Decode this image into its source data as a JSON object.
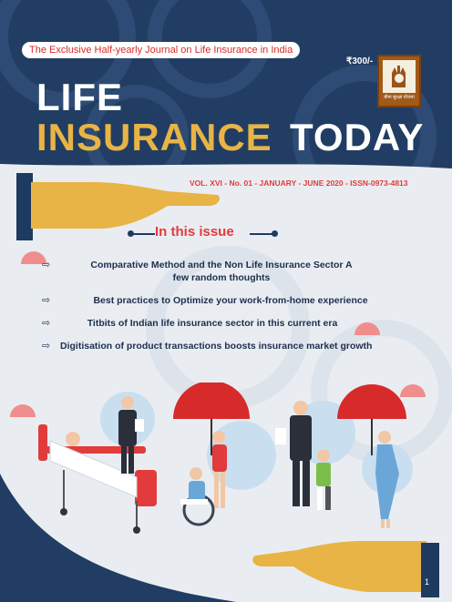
{
  "header": {
    "tagline": "The Exclusive Half-yearly Journal on Life Insurance in India",
    "price": "₹300/-",
    "emblem_text": "बीमा सुरक्षा योजना",
    "title_line1": "LIFE",
    "title_line2a": "INSURANCE",
    "title_line2b": "TODAY",
    "volume_info": "VOL. XVI - No. 01 - JANUARY - JUNE 2020 - ISSN-0973-4813"
  },
  "issue": {
    "heading": "In this issue",
    "items": [
      {
        "text": "Comparative Method and the Non Life Insurance Sector A few random thoughts"
      },
      {
        "text": "Best practices to Optimize your work-from-home experience"
      },
      {
        "text": "Titbits of Indian life insurance sector in this current era"
      },
      {
        "text": "Digitisation of product transactions boosts insurance market growth"
      }
    ]
  },
  "footer": {
    "page_number": "1"
  },
  "colors": {
    "navy": "#223d63",
    "gold": "#e8b445",
    "red": "#e23b3b",
    "light_panel": "#e9edf2"
  }
}
